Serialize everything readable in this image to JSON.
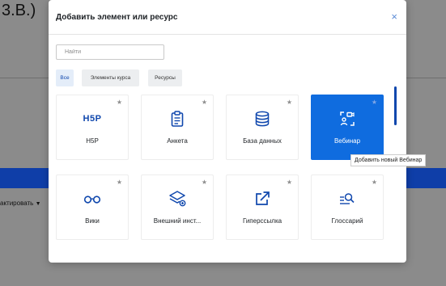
{
  "background": {
    "top_text": "3.B.)",
    "edit_text": "актировать",
    "edit_caret": "▼"
  },
  "modal": {
    "title": "Добавить элемент или ресурс",
    "close_glyph": "×",
    "search_placeholder": "Найти",
    "tabs": [
      "Все",
      "Элементы курса",
      "Ресурсы"
    ],
    "active_tab": "Все"
  },
  "items": [
    {
      "label": "H5P",
      "icon": "h5p-icon",
      "icon_text": "H5P",
      "selected": false
    },
    {
      "label": "Анкета",
      "icon": "clipboard-icon",
      "selected": false
    },
    {
      "label": "База данных",
      "icon": "database-icon",
      "selected": false
    },
    {
      "label": "Вебинар",
      "icon": "webinar-icon",
      "selected": true
    },
    {
      "label": "Вики",
      "icon": "glasses-icon",
      "selected": false
    },
    {
      "label": "Внешний инст...",
      "icon": "external-tool-icon",
      "selected": false
    },
    {
      "label": "Гиперссылка",
      "icon": "external-link-icon",
      "selected": false
    },
    {
      "label": "Глоссарий",
      "icon": "glossary-search-icon",
      "selected": false
    }
  ],
  "tooltip": "Добавить новый Вебинар",
  "colors": {
    "accent": "#0f6cdf",
    "icon_blue": "#0f47ad",
    "close_blue": "#5b8bd6",
    "background_blue_bar": "#0f3ea8"
  }
}
